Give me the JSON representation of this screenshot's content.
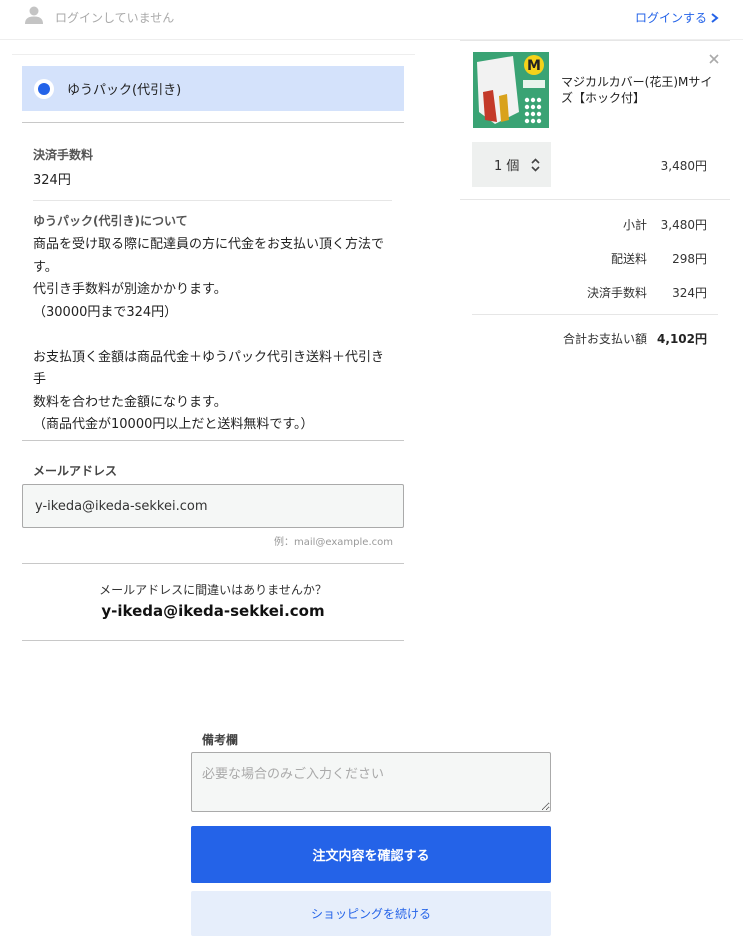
{
  "header": {
    "login_status": "ログインしていません",
    "login_link": "ログインする"
  },
  "payment": {
    "option_label": "ゆうパック(代引き)",
    "fee_title": "決済手数料",
    "fee_value": "324円",
    "desc_title": "ゆうパック(代引き)について",
    "desc_lines": [
      "商品を受け取る際に配達員の方に代金をお支払い頂く方法で",
      "す。",
      "代引き手数料が別途かかります。",
      "（30000円まで324円）",
      "",
      "お支払頂く金額は商品代金＋ゆうパック代引き送料＋代引き手",
      "数料を合わせた金額になります。",
      "（商品代金が10000円以上だと送料無料です。）"
    ]
  },
  "email": {
    "title": "メールアドレス",
    "value": "y-ikeda@ikeda-sekkei.com",
    "example": "例：mail@example.com",
    "confirm_question": "メールアドレスに間違いはありませんか？",
    "confirm_value": "y-ikeda@ikeda-sekkei.com"
  },
  "cart": {
    "thumb_letter": "M",
    "product_name": "マジカルカバー(花王)Mサイズ【ホック付】",
    "quantity": "1 個",
    "price": "3,480円"
  },
  "summary": {
    "subtotal_label": "小計",
    "subtotal_value": "3,480円",
    "shipping_label": "配送料",
    "shipping_value": "298円",
    "fee_label": "決済手数料",
    "fee_value": "324円",
    "total_label": "合計お支払い額",
    "total_value": "4,102円"
  },
  "memo": {
    "title": "備考欄",
    "placeholder": "必要な場合のみご入力ください"
  },
  "buttons": {
    "submit": "注文内容を確認する",
    "continue": "ショッピングを続ける"
  },
  "colors": {
    "accent": "#2463e8",
    "selected_bg": "#d4e2fb",
    "product_bg": "#3aa374"
  }
}
